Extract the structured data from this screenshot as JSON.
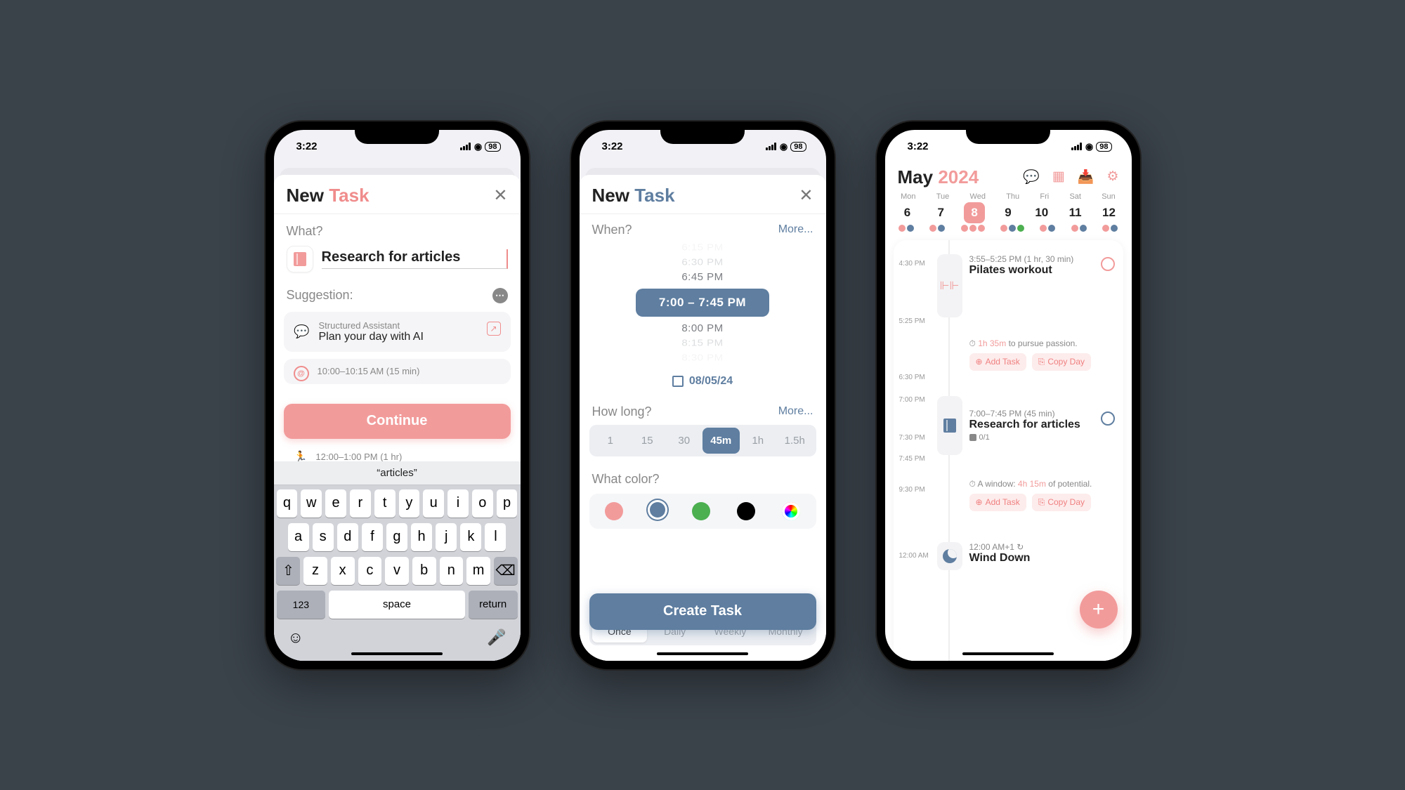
{
  "status": {
    "time": "3:22",
    "battery": "98"
  },
  "screen1": {
    "title_new": "New",
    "title_task": "Task",
    "what_label": "What?",
    "task_value": "Research for articles",
    "suggestion_label": "Suggestion:",
    "assistant": {
      "sub": "Structured Assistant",
      "main": "Plan your day with AI"
    },
    "slot1_time": "10:00–10:15 AM (15 min)",
    "slot2_time": "12:00–1:00 PM (1 hr)",
    "continue_label": "Continue",
    "keyboard": {
      "suggestion": "“articles”",
      "row1": [
        "q",
        "w",
        "e",
        "r",
        "t",
        "y",
        "u",
        "i",
        "o",
        "p"
      ],
      "row2": [
        "a",
        "s",
        "d",
        "f",
        "g",
        "h",
        "j",
        "k",
        "l"
      ],
      "row3": [
        "z",
        "x",
        "c",
        "v",
        "b",
        "n",
        "m"
      ],
      "num": "123",
      "space": "space",
      "return": "return"
    }
  },
  "screen2": {
    "title_new": "New",
    "title_task": "Task",
    "when_label": "When?",
    "more_label": "More...",
    "times": {
      "t0": "6:15 PM",
      "t1": "6:30 PM",
      "t2": "6:45 PM",
      "selected": "7:00 – 7:45 PM",
      "t3": "8:00 PM",
      "t4": "8:15 PM",
      "t5": "8:30 PM"
    },
    "date": "08/05/24",
    "howlong_label": "How long?",
    "durations": {
      "d1": "1",
      "d2": "15",
      "d3": "30",
      "d4": "45m",
      "d5": "1h",
      "d6": "1.5h"
    },
    "color_label": "What color?",
    "create_label": "Create Task",
    "repeat": {
      "once": "Once",
      "daily": "Daily",
      "weekly": "Weekly",
      "monthly": "Monthly"
    }
  },
  "screen3": {
    "month": "May",
    "year": "2024",
    "weekdays": [
      "Mon",
      "Tue",
      "Wed",
      "Thu",
      "Fri",
      "Sat",
      "Sun"
    ],
    "dates": [
      "6",
      "7",
      "8",
      "9",
      "10",
      "11",
      "12"
    ],
    "timeline": {
      "t430": "4:30 PM",
      "t525": "5:25 PM",
      "t630": "6:30 PM",
      "t700": "7:00 PM",
      "t730": "7:30 PM",
      "t745": "7:45 PM",
      "t930": "9:30 PM",
      "t1200": "12:00 AM"
    },
    "evt1": {
      "time": "3:55–5:25 PM (1 hr, 30 min)",
      "title": "Pilates workout"
    },
    "gap1": {
      "dur": "1h 35m",
      "text": " to pursue passion."
    },
    "add_task": "Add Task",
    "copy_day": "Copy Day",
    "evt2": {
      "time": "7:00–7:45 PM (45 min)",
      "title": "Research for articles",
      "sub": "0/1"
    },
    "gap2": {
      "pre": "A window: ",
      "dur": "4h 15m",
      "text": " of potential."
    },
    "evt3": {
      "time": "12:00 AM+1 ↻",
      "title": "Wind Down"
    }
  }
}
